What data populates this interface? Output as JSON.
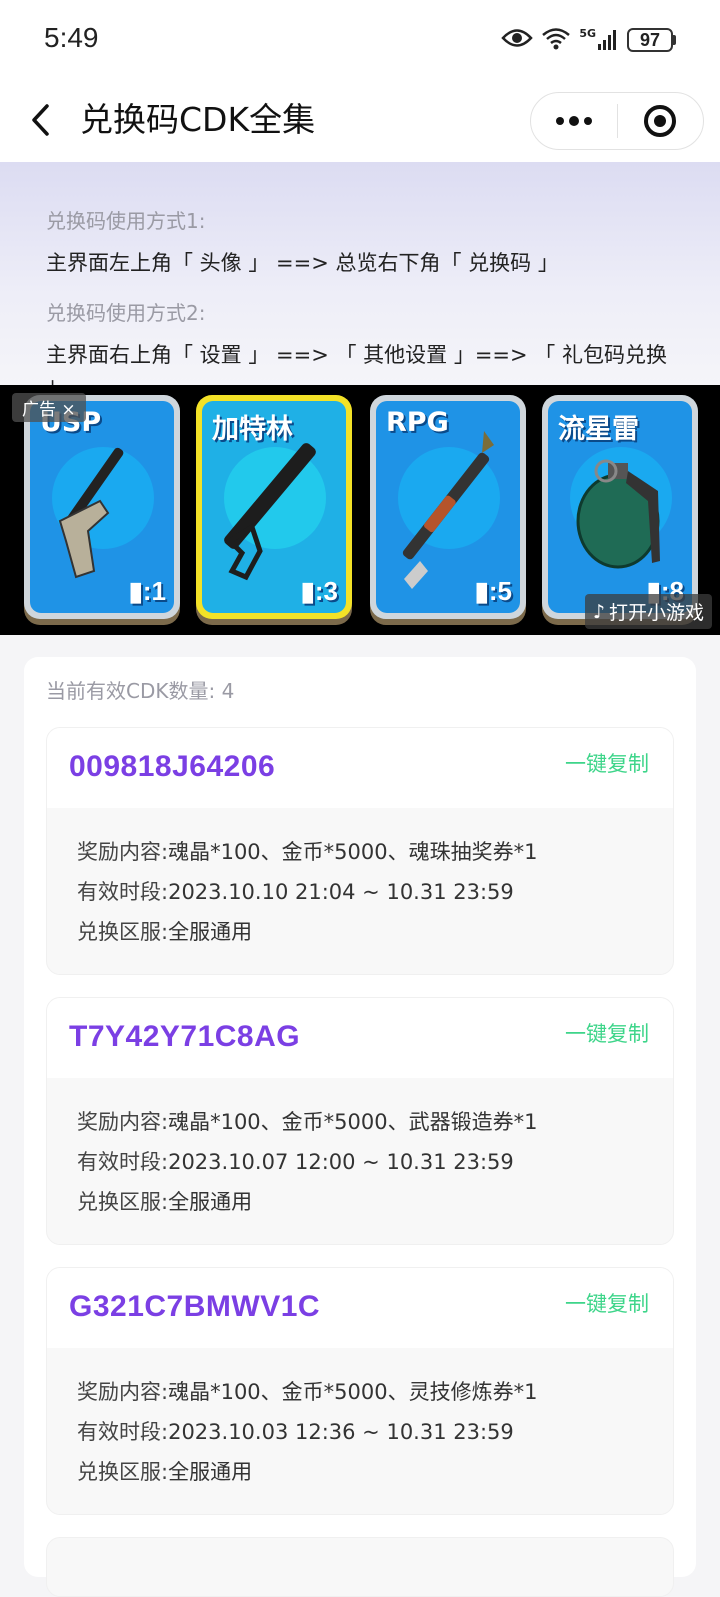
{
  "status_bar": {
    "time": "5:49",
    "network": "5G",
    "battery": "97",
    "icons": [
      "eye-icon",
      "wifi-icon",
      "signal-icon",
      "battery-icon"
    ]
  },
  "nav": {
    "title": "兑换码CDK全集",
    "icons": [
      "back-chevron-icon",
      "more-dots-icon",
      "close-target-icon"
    ]
  },
  "usage": {
    "method1_label": "兑换码使用方式1:",
    "method1_text": "主界面左上角「 头像 」 ==> 总览右下角「 兑换码 」",
    "method2_label": "兑换码使用方式2:",
    "method2_text": "主界面右上角「 设置 」 ==> 「 其他设置 」==> 「 礼包码兑换 」"
  },
  "ad": {
    "tag": "广告",
    "open_game": "打开小游戏",
    "cards": [
      {
        "name": "USP",
        "count": ":1",
        "icon": "pistol-icon"
      },
      {
        "name": "加特林",
        "count": ":3",
        "icon": "gatling-icon"
      },
      {
        "name": "RPG",
        "count": ":5",
        "icon": "rpg-icon"
      },
      {
        "name": "流星雷",
        "count": ":8",
        "icon": "grenade-icon"
      }
    ],
    "colors": {
      "card_blue": "#1f93e6",
      "card_gold": "#f3e227"
    }
  },
  "cdk": {
    "count_text": "当前有效CDK数量: 4",
    "copy_label": "一键复制",
    "labels": {
      "reward": "奖励内容:",
      "period": "有效时段:",
      "server": "兑换区服:"
    },
    "items": [
      {
        "code": "009818J64206",
        "reward": "魂晶*100、金币*5000、魂珠抽奖券*1",
        "period": "2023.10.10 21:04 ~ 10.31 23:59",
        "server": "全服通用"
      },
      {
        "code": "T7Y42Y71C8AG",
        "reward": "魂晶*100、金币*5000、武器锻造券*1",
        "period": "2023.10.07 12:00 ~ 10.31 23:59",
        "server": "全服通用"
      },
      {
        "code": "G321C7BMWV1C",
        "reward": "魂晶*100、金币*5000、灵技修炼券*1",
        "period": "2023.10.03 12:36 ~ 10.31 23:59",
        "server": "全服通用"
      }
    ],
    "colors": {
      "code": "#7b3fe4",
      "copy": "#3ed58a"
    }
  }
}
